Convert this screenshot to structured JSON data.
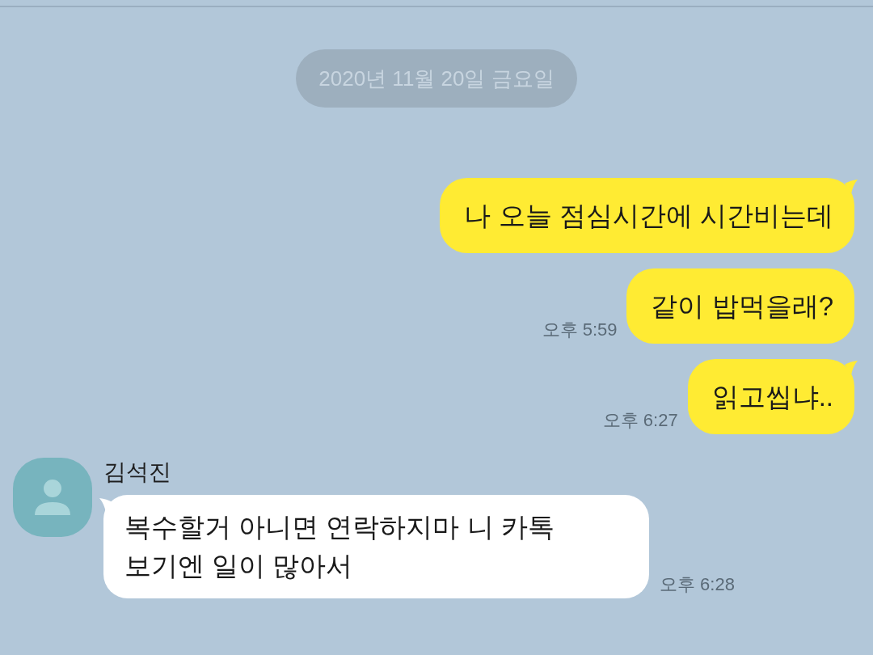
{
  "date_divider": "2020년 11월 20일 금요일",
  "messages": [
    {
      "kind": "sent",
      "tail": true,
      "text": "나 오늘 점심시간에 시간비는데"
    },
    {
      "kind": "sent",
      "tail": false,
      "text": "같이 밥먹을래?",
      "time": "오후 5:59"
    },
    {
      "kind": "sent",
      "tail": true,
      "text": "읽고씹냐..",
      "time": "오후 6:27"
    },
    {
      "kind": "received",
      "tail": true,
      "sender": "김석진",
      "text": "복수할거 아니면 연락하지마 니 카톡\n보기엔 일이 많아서",
      "time": "오후 6:28"
    }
  ]
}
